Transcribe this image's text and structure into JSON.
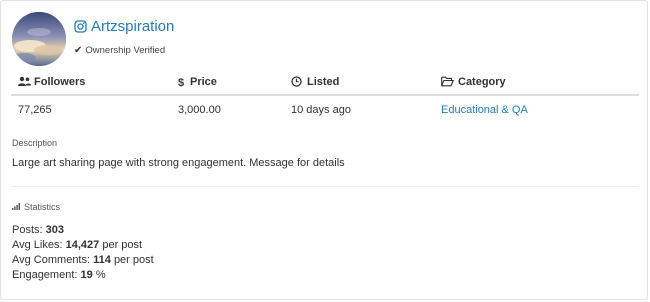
{
  "account": {
    "name": "Artzspiration",
    "platform_icon": "instagram-icon",
    "verified_label": "Ownership Verified"
  },
  "table": {
    "headers": {
      "followers": "Followers",
      "price": "Price",
      "listed": "Listed",
      "category": "Category"
    },
    "row": {
      "followers": "77,265",
      "price": "3,000.00",
      "listed": "10 days ago",
      "category": "Educational & QA"
    }
  },
  "description": {
    "label": "Description",
    "text": "Large art sharing page with strong engagement. Message for details"
  },
  "statistics": {
    "label": "Statistics",
    "posts_label": "Posts:",
    "posts_value": "303",
    "avg_likes_label": "Avg Likes:",
    "avg_likes_value": "14,427",
    "avg_likes_suffix": "per post",
    "avg_comments_label": "Avg Comments:",
    "avg_comments_value": "114",
    "avg_comments_suffix": "per post",
    "engagement_label": "Engagement:",
    "engagement_value": "19",
    "engagement_suffix": "%"
  },
  "colors": {
    "link": "#2a7ab8",
    "text": "#333333",
    "divider": "#dddddd"
  }
}
